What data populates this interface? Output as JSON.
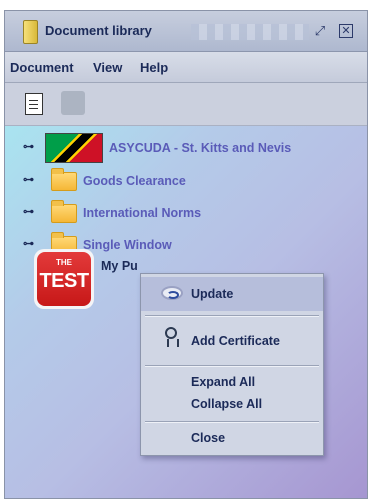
{
  "window": {
    "title": "Document library",
    "restore_glyph": "⤢",
    "close_glyph": "⊠"
  },
  "menubar": {
    "items": [
      "Document",
      "View",
      "Help"
    ]
  },
  "toolbar": {
    "buttons": [
      {
        "icon": "document-icon",
        "enabled": true
      },
      {
        "icon": "chat-bubble-icon",
        "enabled": false
      }
    ]
  },
  "tree": {
    "expander_glyph": "⊶",
    "items": [
      {
        "label": "ASYCUDA - St. Kitts and Nevis",
        "icon": "flag-icon"
      },
      {
        "label": "Goods Clearance",
        "icon": "folder-icon"
      },
      {
        "label": "International Norms",
        "icon": "folder-icon"
      },
      {
        "label": "Single Window",
        "icon": "folder-icon"
      }
    ],
    "selected": {
      "label": "My Pu",
      "icon_text_top": "THE",
      "icon_text_main": "TEST"
    }
  },
  "context_menu": {
    "items": [
      {
        "label": "Update",
        "icon": "update-icon",
        "highlighted": true
      },
      {
        "label": "Add Certificate",
        "icon": "certificate-icon"
      },
      {
        "label": "Expand All"
      },
      {
        "label": "Collapse All"
      },
      {
        "label": "Close"
      }
    ]
  },
  "colors": {
    "tree_label": "#5a5bb8",
    "menu_text": "#1b2a58"
  }
}
